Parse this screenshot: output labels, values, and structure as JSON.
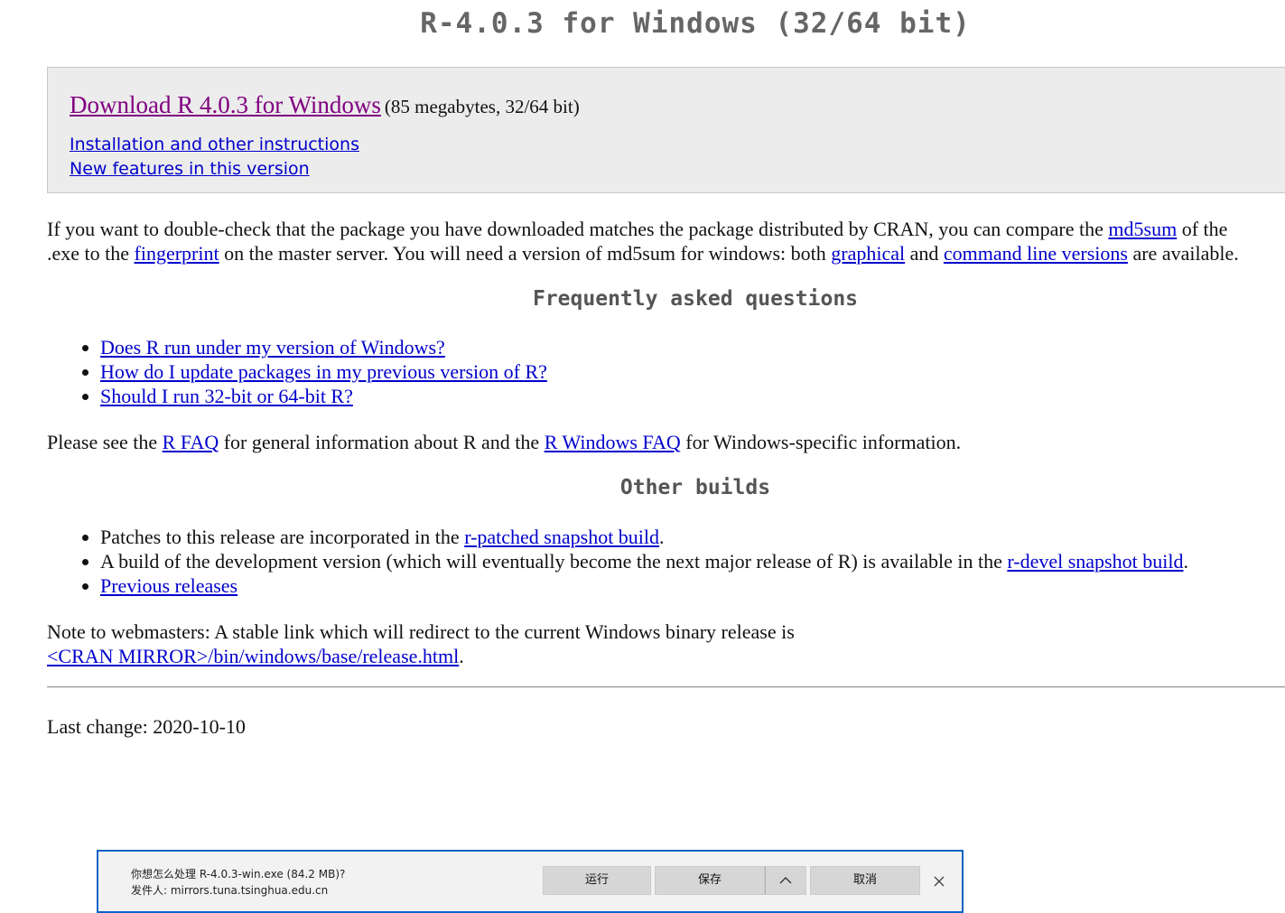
{
  "page": {
    "title": "R-4.0.3 for Windows (32/64 bit)"
  },
  "download_box": {
    "main_link": "Download R 4.0.3 for Windows",
    "meta": "(85 megabytes, 32/64 bit)",
    "links": [
      "Installation and other instructions",
      "New features in this version"
    ]
  },
  "checksum_para": {
    "line1_pre": "If you want to double-check that the package you have downloaded matches the package distributed by CRAN, you can compare the ",
    "md5sum_link": "md5sum",
    "line1_post": " of the",
    "line2_pre": ".exe to the ",
    "fingerprint_link": "fingerprint",
    "line2_mid": " on the master server. You will need a version of md5sum for windows: both ",
    "graphical_link": "graphical",
    "line2_and": " and ",
    "cmdline_link": "command line versions",
    "line2_post": " are available."
  },
  "faq": {
    "heading": "Frequently asked questions",
    "items": [
      "Does R run under my version of Windows?",
      "How do I update packages in my previous version of R?",
      "Should I run 32-bit or 64-bit R?"
    ]
  },
  "faq_para": {
    "pre": "Please see the ",
    "rfaq_link": "R FAQ",
    "mid": " for general information about R and the ",
    "winfaq_link": "R Windows FAQ",
    "post": " for Windows-specific information."
  },
  "other_builds": {
    "heading": "Other builds",
    "item1_pre": "Patches to this release are incorporated in the ",
    "item1_link": "r-patched snapshot build",
    "item1_post": ".",
    "item2_pre": "A build of the development version (which will eventually become the next major release of R) is available in the ",
    "item2_link": "r-devel snapshot build",
    "item2_post": ".",
    "item3_link": "Previous releases"
  },
  "webmaster_note": {
    "line1": "Note to webmasters: A stable link which will redirect to the current Windows binary release is",
    "link": "<CRAN MIRROR>/bin/windows/base/release.html",
    "post": "."
  },
  "last_change": "Last change: 2020-10-10",
  "download_bar": {
    "question": "你想怎么处理 R-4.0.3-win.exe (84.2 MB)?",
    "publisher": "发件人: mirrors.tuna.tsinghua.edu.cn",
    "run_label": "运行",
    "save_label": "保存",
    "more_icon": "chevron-up-icon",
    "cancel_label": "取消",
    "close_icon": "close-icon"
  }
}
